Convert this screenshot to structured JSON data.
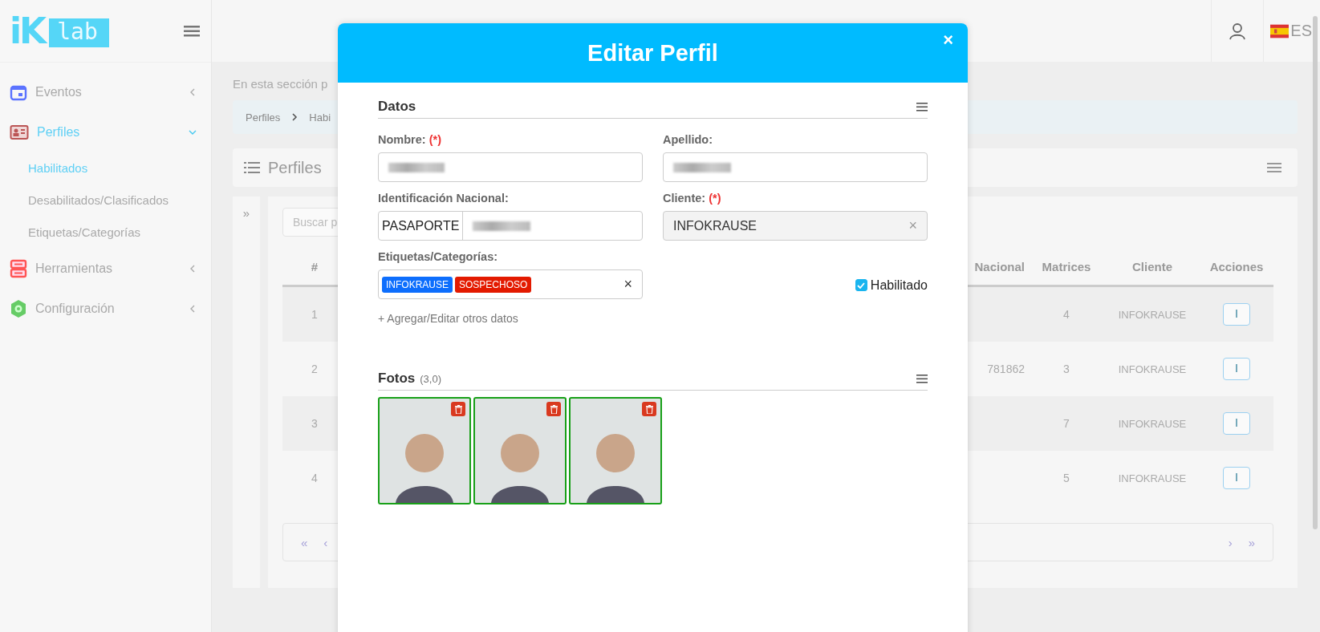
{
  "logo": {
    "mark": "iK",
    "text": "lab"
  },
  "header": {
    "language": "ES"
  },
  "sidebar": {
    "items": [
      {
        "label": "Eventos",
        "expanded": false,
        "selected": false
      },
      {
        "label": "Perfiles",
        "expanded": true,
        "selected": true,
        "children": [
          {
            "label": "Habilitados",
            "selected": true
          },
          {
            "label": "Desabilitados/Clasificados",
            "selected": false
          },
          {
            "label": "Etiquetas/Categorías",
            "selected": false
          }
        ]
      },
      {
        "label": "Herramientas",
        "expanded": false,
        "selected": false
      },
      {
        "label": "Configuración",
        "expanded": false,
        "selected": false
      }
    ]
  },
  "intro": "En esta sección p",
  "breadcrumb": [
    "Perfiles",
    "Habi"
  ],
  "panel": {
    "title": "Perfiles",
    "collapse": "»",
    "search": {
      "placeholder": "Buscar p"
    },
    "table": {
      "columns": [
        "#",
        "Nacional",
        "Matrices",
        "Cliente",
        "Acciones"
      ],
      "rows": [
        {
          "index": "1",
          "national": "",
          "matrices": "4",
          "client": "INFOKRAUSE"
        },
        {
          "index": "2",
          "national": "781862",
          "matrices": "3",
          "client": "INFOKRAUSE"
        },
        {
          "index": "3",
          "national": "",
          "matrices": "7",
          "client": "INFOKRAUSE"
        },
        {
          "index": "4",
          "national": "",
          "matrices": "5",
          "client": "INFOKRAUSE"
        }
      ]
    },
    "pagination": {
      "first": "«",
      "prev": "‹",
      "next": "›",
      "last": "»"
    }
  },
  "modal": {
    "title": "Editar Perfil",
    "close": "×",
    "datos": {
      "title": "Datos",
      "nombre": {
        "label": "Nombre:",
        "required": "(*)",
        "blurred": true
      },
      "apellido": {
        "label": "Apellido:",
        "blurred": true
      },
      "identificacion": {
        "label": "Identificación Nacional:",
        "prefix": "PASAPORTE",
        "blurred": true
      },
      "cliente": {
        "label": "Cliente:",
        "required": "(*)",
        "value": "INFOKRAUSE",
        "disabled": true,
        "clear": "×"
      },
      "etiquetas": {
        "label": "Etiquetas/Categorías:",
        "clear": "×",
        "tags": [
          {
            "label": "INFOKRAUSE",
            "color": "#0d6efd"
          },
          {
            "label": "SOSPECHOSO",
            "color": "#e31a00"
          }
        ]
      },
      "habilitado": {
        "label": "Habilitado",
        "checked": true
      },
      "more_link": "+ Agregar/Editar otros datos"
    },
    "fotos": {
      "title": "Fotos",
      "count": "(3,0)",
      "photos": [
        {
          "valid": true
        },
        {
          "valid": true
        },
        {
          "valid": true
        }
      ]
    }
  }
}
